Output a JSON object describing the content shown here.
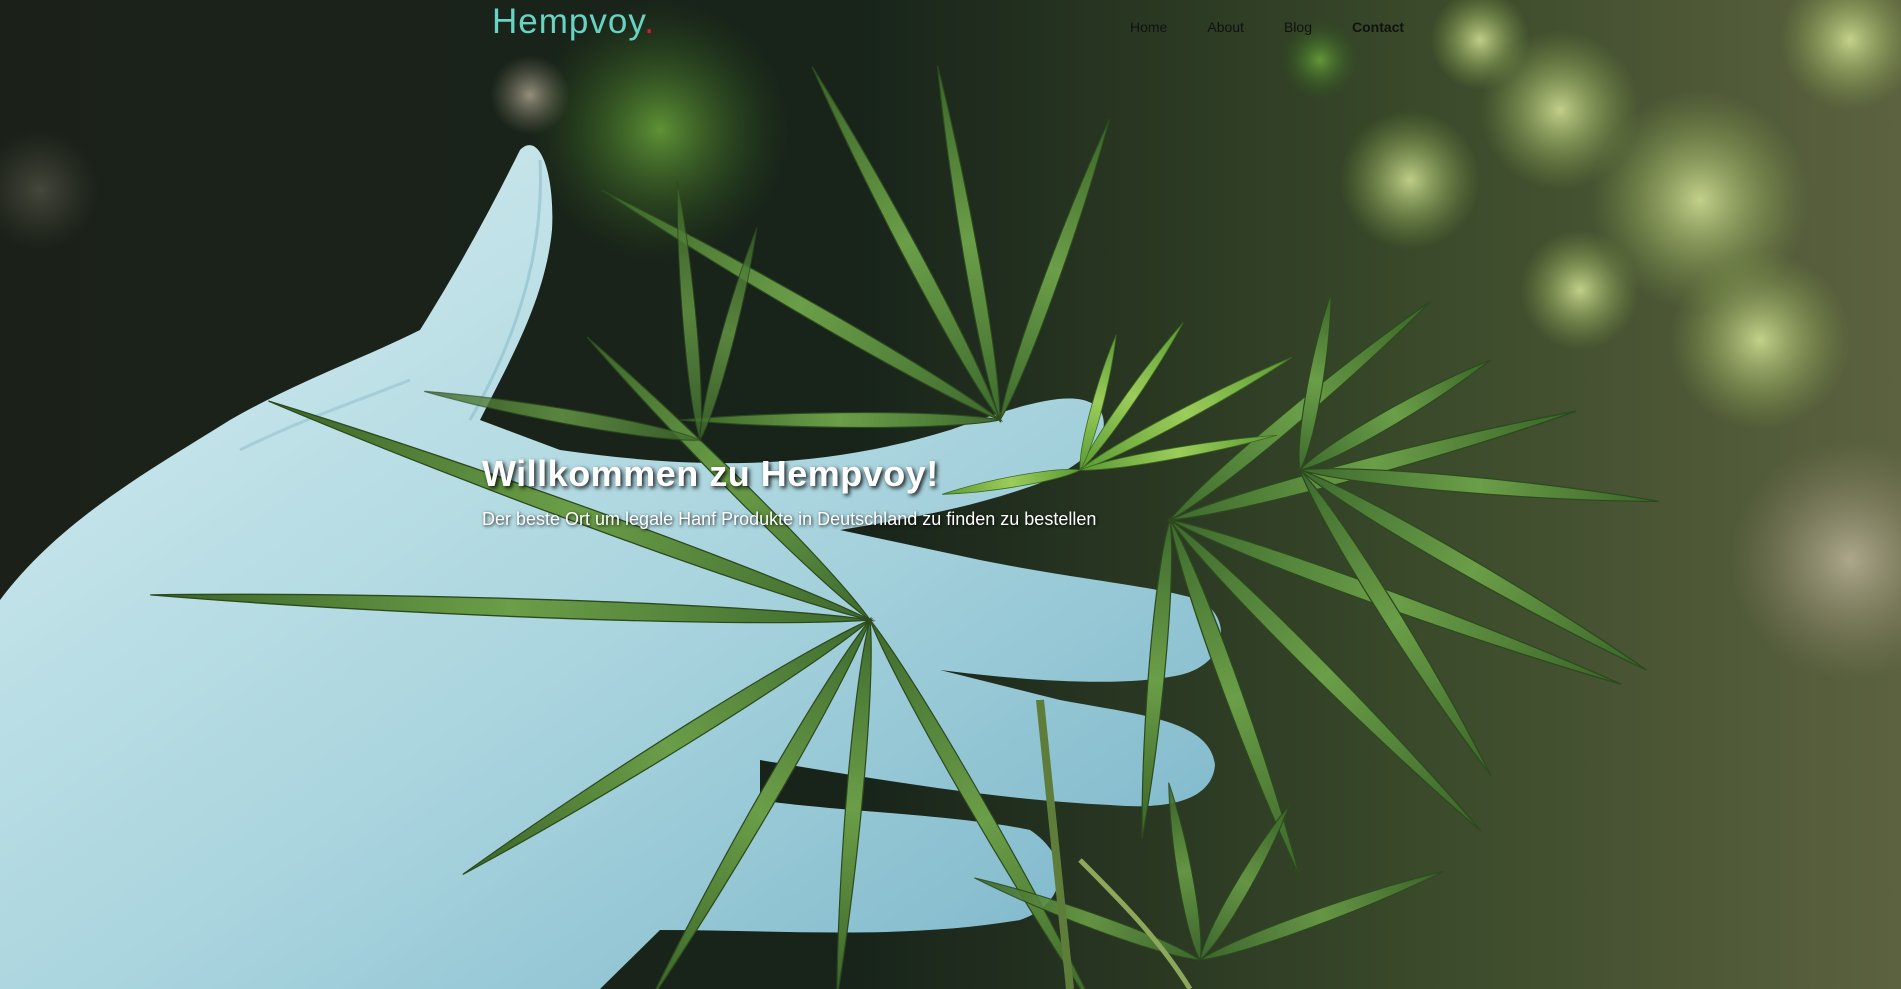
{
  "site": {
    "brand_name": "Hempvoy",
    "brand_dot": ".",
    "brand_color": "#67d3c2",
    "brand_dot_color": "#e0162b"
  },
  "nav": {
    "items": [
      {
        "label": "Home"
      },
      {
        "label": "About"
      },
      {
        "label": "Blog"
      },
      {
        "label": "Contact"
      }
    ]
  },
  "hero": {
    "title": "Willkommen zu Hempvoy!",
    "subtitle": "Der beste Ort um legale Hanf Produkte in Deutschland zu finden zu bestellen",
    "image_subject": "gloved-hand-holding-hemp-leaves"
  }
}
